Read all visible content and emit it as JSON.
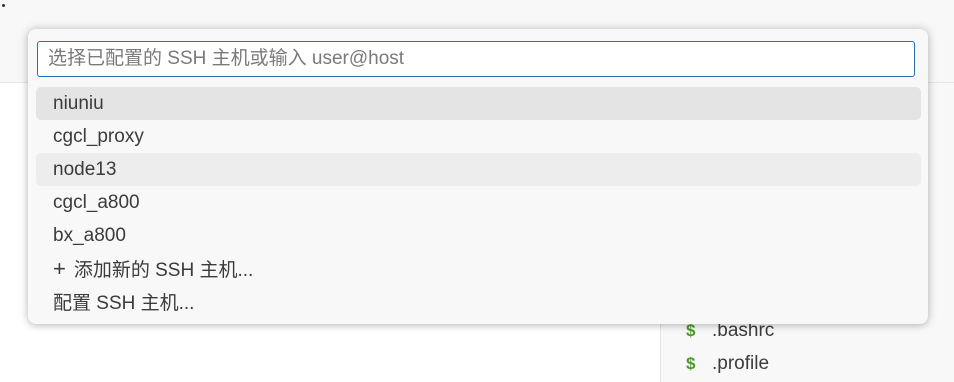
{
  "quick_pick": {
    "search": {
      "placeholder": "选择已配置的 SSH 主机或输入 user@host",
      "value": ""
    },
    "items": [
      {
        "label": "niuniu"
      },
      {
        "label": "cgcl_proxy"
      },
      {
        "label": "node13"
      },
      {
        "label": "cgcl_a800"
      },
      {
        "label": "bx_a800"
      },
      {
        "label": "添加新的 SSH 主机...",
        "icon": "plus-icon"
      },
      {
        "label": "配置 SSH 主机..."
      }
    ]
  },
  "explorer": {
    "files": [
      {
        "name": ".bashrc",
        "icon": "dollar-icon"
      },
      {
        "name": ".profile",
        "icon": "dollar-icon"
      }
    ]
  },
  "colors": {
    "focus_border": "#2a6fb0",
    "shell_icon": "#4c9a2a",
    "active_item_bg": "#e4e4e4"
  }
}
